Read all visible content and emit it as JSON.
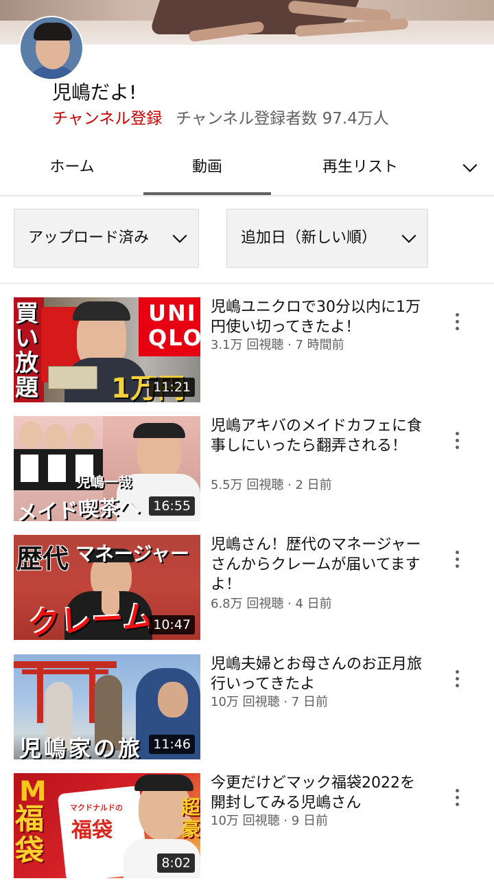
{
  "channel": {
    "name": "児嶋だよ!",
    "subscribe_label": "チャンネル登録",
    "subscriber_count": "チャンネル登録者数 97.4万人"
  },
  "tabs": [
    {
      "label": "ホーム",
      "active": false
    },
    {
      "label": "動画",
      "active": true
    },
    {
      "label": "再生リスト",
      "active": false
    }
  ],
  "filters": {
    "upload": "アップロード済み",
    "sort": "追加日（新しい順）"
  },
  "videos": [
    {
      "title": "児嶋ユニクロで30分以内に1万円使い切ってきたよ！",
      "meta": "3.1万 回視聴 · 7 時間前",
      "duration": "11:21",
      "thumb_text": [
        "買い放題",
        "UNI",
        "QLO",
        "1万円"
      ]
    },
    {
      "title": "児嶋アキバのメイドカフェに食事しにいったら翻弄される！",
      "meta": "5.5万 回視聴 · 2 日前",
      "duration": "16:55",
      "thumb_text": [
        "児嶋一哉",
        "メイド喫茶へ"
      ]
    },
    {
      "title": "児嶋さん！歴代のマネージャーさんからクレームが届いてますよ！",
      "meta": "6.8万 回視聴 · 4 日前",
      "duration": "10:47",
      "thumb_text": [
        "歴代",
        "マネージャー",
        "クレーム"
      ]
    },
    {
      "title": "児嶋夫婦とお母さんのお正月旅行いってきたよ",
      "meta": "10万 回視聴 · 7 日前",
      "duration": "11:46",
      "thumb_text": [
        "児嶋家の旅"
      ]
    },
    {
      "title": "今更だけどマック福袋2022を開封してみる児嶋さん",
      "meta": "10万 回視聴 · 9 日前",
      "duration": "8:02",
      "thumb_text": [
        "福袋",
        "マクドナルドの",
        "福袋",
        "超豪"
      ]
    }
  ]
}
